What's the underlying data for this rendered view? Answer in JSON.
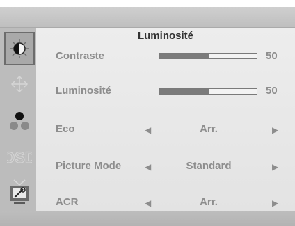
{
  "menu": {
    "title": "Luminosité",
    "arrow_left": "◀",
    "arrow_right": "▶"
  },
  "sidebar": {
    "items": [
      {
        "icon": "brightness-contrast-icon",
        "active": true
      },
      {
        "icon": "position-arrows-icon",
        "active": false
      },
      {
        "icon": "color-dots-icon",
        "active": false
      },
      {
        "icon": "osd-icon",
        "active": false
      },
      {
        "icon": "setup-tools-icon",
        "active": false
      }
    ]
  },
  "rows": {
    "contraste": {
      "label": "Contraste",
      "value": "50",
      "level": 0.5
    },
    "luminosite": {
      "label": "Luminosité",
      "value": "50",
      "level": 0.5
    },
    "eco": {
      "label": "Eco",
      "value": "Arr."
    },
    "picture_mode": {
      "label": "Picture Mode",
      "value": "Standard"
    },
    "acr": {
      "label": "ACR",
      "value": "Arr."
    }
  },
  "colors": {
    "accent": "#7b7b7b",
    "text_dim": "#8d8d8d",
    "title": "#333333"
  }
}
